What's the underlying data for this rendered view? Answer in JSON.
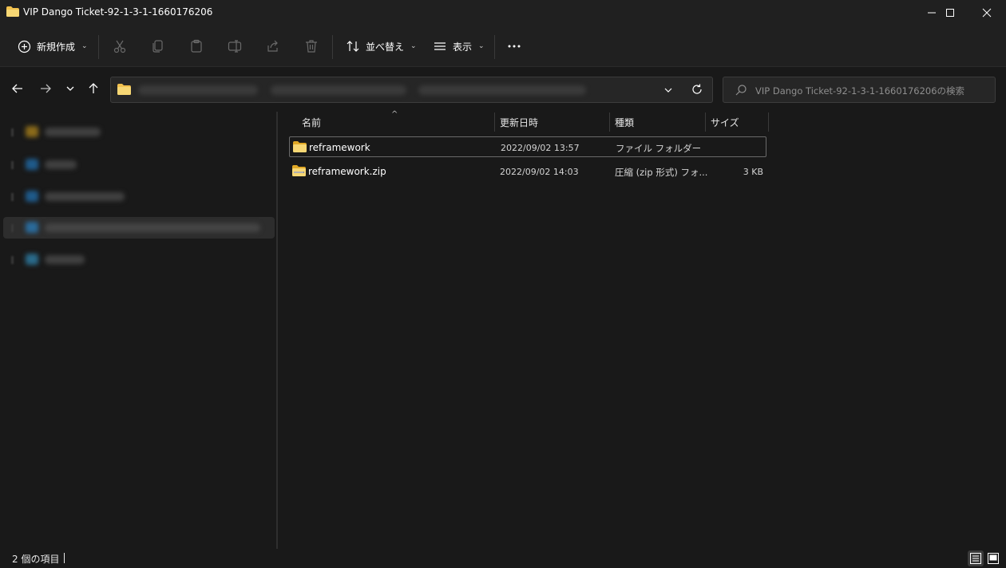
{
  "window": {
    "title": "VIP Dango Ticket-92-1-3-1-1660176206"
  },
  "toolbar": {
    "new_label": "新規作成",
    "sort_label": "並べ替え",
    "view_label": "表示"
  },
  "search": {
    "placeholder": "VIP Dango Ticket-92-1-3-1-1660176206の検索"
  },
  "columns": {
    "name": "名前",
    "date": "更新日時",
    "type": "種類",
    "size": "サイズ"
  },
  "files": [
    {
      "name": "reframework",
      "date": "2022/09/02 13:57",
      "type": "ファイル フォルダー",
      "size": "",
      "icon": "folder-icon"
    },
    {
      "name": "reframework.zip",
      "date": "2022/09/02 14:03",
      "type": "圧縮 (zip 形式) フォ...",
      "size": "3 KB",
      "icon": "zip-folder-icon"
    }
  ],
  "status": {
    "item_count": "2 個の項目"
  },
  "colors": {
    "background": "#191919",
    "titlebar": "#202020",
    "folder_yellow": "#f2c14e",
    "selection_border": "#6a6a6a"
  }
}
